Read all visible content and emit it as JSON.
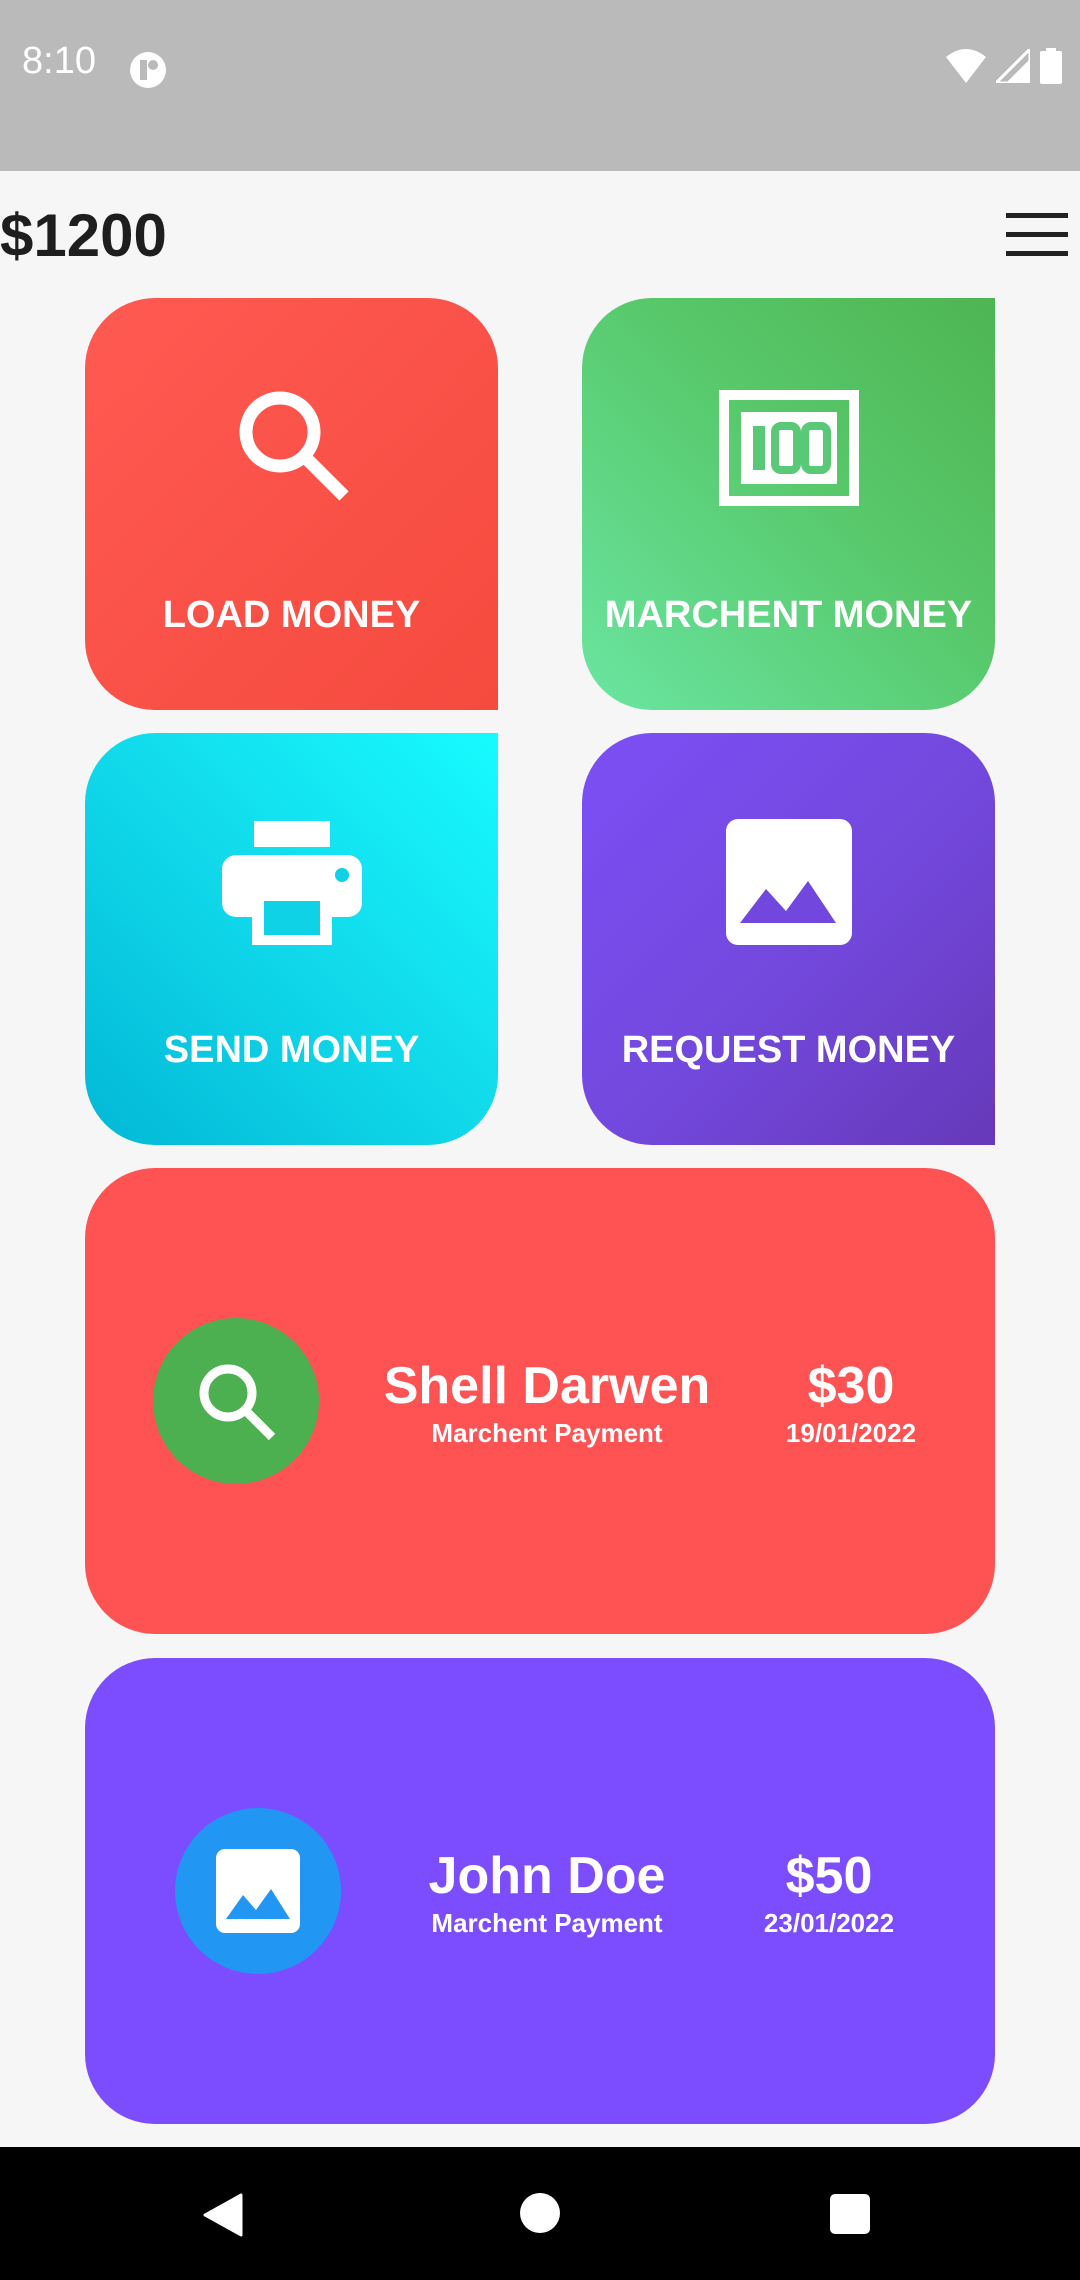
{
  "status_bar": {
    "time": "8:10",
    "icons": [
      "app-notification-icon",
      "wifi-icon",
      "signal-icon",
      "battery-icon"
    ]
  },
  "header": {
    "balance": "$1200",
    "menu_icon": "hamburger-menu-icon"
  },
  "actions": [
    {
      "label": "LOAD MONEY",
      "icon": "search-icon",
      "colors": [
        "#ff5a52",
        "#f54a3e"
      ]
    },
    {
      "label": "MARCHENT MONEY",
      "icon": "money-100-icon",
      "colors": [
        "#6ae6a2",
        "#4eb552"
      ]
    },
    {
      "label": "SEND MONEY",
      "icon": "printer-icon",
      "colors": [
        "#02b8d6",
        "#16fbff"
      ]
    },
    {
      "label": "REQUEST MONEY",
      "icon": "image-icon",
      "colors": [
        "#7c4ff5",
        "#6639b8"
      ]
    }
  ],
  "transactions": [
    {
      "name": "Shell Darwen",
      "type": "Marchent Payment",
      "amount": "$30",
      "date": "19/01/2022",
      "icon": "search-icon",
      "card_color": "#ff5252",
      "avatar_color": "#4caf50"
    },
    {
      "name": "John Doe",
      "type": "Marchent Payment",
      "amount": "$50",
      "date": "23/01/2022",
      "icon": "image-icon",
      "card_color": "#7c4dff",
      "avatar_color": "#2196f3"
    }
  ],
  "nav_bar": {
    "icons": [
      "back-icon",
      "home-icon",
      "recents-icon"
    ]
  }
}
